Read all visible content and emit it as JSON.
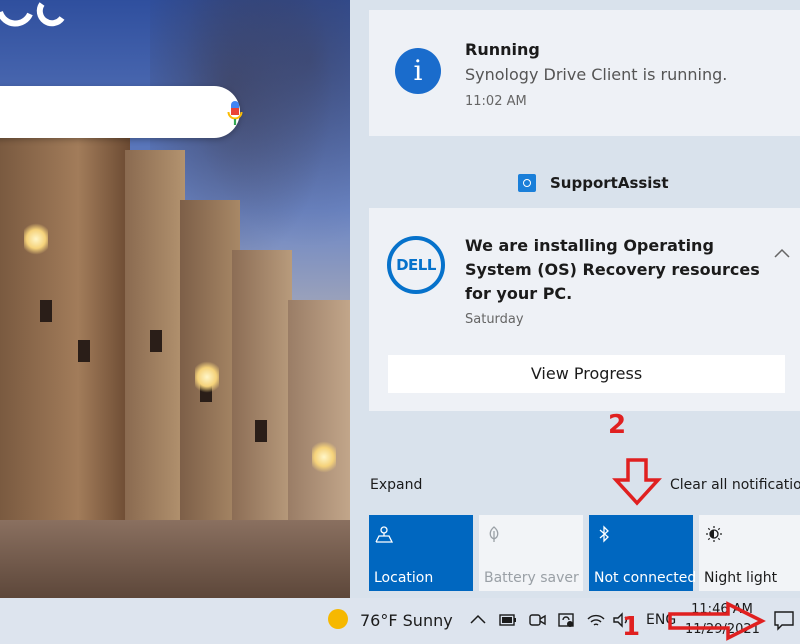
{
  "notifications": [
    {
      "title": "Running",
      "body": "Synology Drive Client is running.",
      "time": "11:02 AM"
    }
  ],
  "app_group": {
    "name": "SupportAssist",
    "notification": {
      "title": "We are installing Operating System (OS) Recovery resources for your PC.",
      "time": "Saturday",
      "button": "View Progress"
    }
  },
  "controls": {
    "expand": "Expand",
    "clear_all": "Clear all notifications"
  },
  "quick_actions": [
    {
      "label": "Location",
      "icon": "location-icon",
      "state": "on"
    },
    {
      "label": "Battery saver",
      "icon": "battery-saver-icon",
      "state": "disabled"
    },
    {
      "label": "Not connected",
      "icon": "bluetooth-icon",
      "state": "on"
    },
    {
      "label": "Night light",
      "icon": "night-light-icon",
      "state": "off"
    }
  ],
  "taskbar": {
    "weather": "76°F  Sunny",
    "language": "ENG",
    "time": "11:46 AM",
    "date": "11/29/2021"
  },
  "annotations": {
    "step1": "1",
    "step2": "2"
  },
  "colors": {
    "accent": "#0067c0",
    "annotation": "#e02020"
  }
}
